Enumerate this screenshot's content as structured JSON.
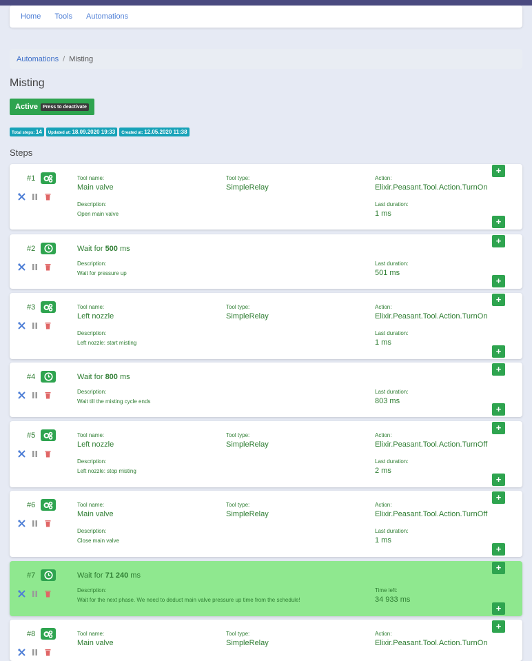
{
  "nav": {
    "items": [
      "Home",
      "Tools",
      "Automations"
    ]
  },
  "breadcrumb": {
    "link": "Automations",
    "separator": "/",
    "current": "Misting"
  },
  "page": {
    "title": "Misting"
  },
  "status": {
    "label": "Active",
    "action": "Press to deactivate"
  },
  "badges": [
    {
      "label": "Total steps:",
      "value": "14"
    },
    {
      "label": "Updated at:",
      "value": "18.09.2020 19:33"
    },
    {
      "label": "Created at:",
      "value": "12.05.2020 11:38"
    }
  ],
  "steps_title": "Steps",
  "labels": {
    "tool_name": "Tool name:",
    "tool_type": "Tool type:",
    "action": "Action:",
    "description": "Description:",
    "last_duration": "Last duration:",
    "time_left": "Time left:",
    "wait_for": "Wait for",
    "ms": "ms",
    "plus": "+"
  },
  "steps": [
    {
      "num": "#1",
      "kind": "tool",
      "tool_name": "Main valve",
      "tool_type": "SimpleRelay",
      "action": "Elixir.Peasant.Tool.Action.TurnOn",
      "description": "Open main valve",
      "last_duration": "1 ms"
    },
    {
      "num": "#2",
      "kind": "wait",
      "wait": "500",
      "description": "Wait for pressure up",
      "last_duration": "501 ms"
    },
    {
      "num": "#3",
      "kind": "tool",
      "tool_name": "Left nozzle",
      "tool_type": "SimpleRelay",
      "action": "Elixir.Peasant.Tool.Action.TurnOn",
      "description": "Left nozzle: start misting",
      "last_duration": "1 ms"
    },
    {
      "num": "#4",
      "kind": "wait",
      "wait": "800",
      "description": "Wait till the misting cycle ends",
      "last_duration": "803 ms"
    },
    {
      "num": "#5",
      "kind": "tool",
      "tool_name": "Left nozzle",
      "tool_type": "SimpleRelay",
      "action": "Elixir.Peasant.Tool.Action.TurnOff",
      "description": "Left nozzle: stop misting",
      "last_duration": "2 ms"
    },
    {
      "num": "#6",
      "kind": "tool",
      "tool_name": "Main valve",
      "tool_type": "SimpleRelay",
      "action": "Elixir.Peasant.Tool.Action.TurnOff",
      "description": "Close main valve",
      "last_duration": "1 ms"
    },
    {
      "num": "#7",
      "kind": "wait",
      "current": true,
      "wait": "71 240",
      "description": "Wait for the next phase. We need to deduct main valve pressure up time from the schedule!",
      "time_left": "34 933 ms"
    },
    {
      "num": "#8",
      "kind": "tool",
      "tool_name": "Main valve",
      "tool_type": "SimpleRelay",
      "action": "Elixir.Peasant.Tool.Action.TurnOn"
    }
  ],
  "colors": {
    "accent": "#2ea44f",
    "link": "#4f7fd6",
    "current_step": "#8fe88f",
    "badge": "#17a2b8",
    "navbar": "#4a4a80"
  }
}
